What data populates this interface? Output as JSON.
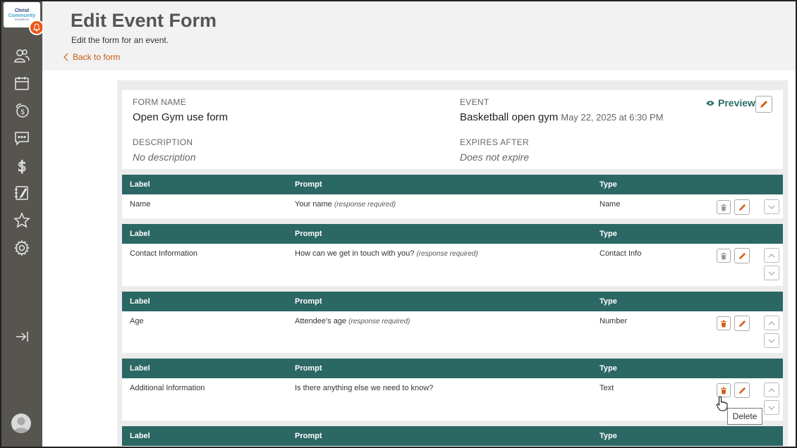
{
  "logo": {
    "line1": "Christ",
    "line2": "Community",
    "line3": "CHURCH"
  },
  "header": {
    "title": "Edit Event Form",
    "subtitle": "Edit the form for an event.",
    "back_link": "Back to form"
  },
  "form": {
    "form_name_label": "FORM NAME",
    "form_name_value": "Open Gym use form",
    "event_label": "EVENT",
    "event_value": "Basketball open gym",
    "event_date": "May 22, 2025 at 6:30 PM",
    "description_label": "DESCRIPTION",
    "description_value": "No description",
    "expires_label": "EXPIRES AFTER",
    "expires_value": "Does not expire",
    "preview_label": "Preview"
  },
  "columns": {
    "label": "Label",
    "prompt": "Prompt",
    "type": "Type"
  },
  "required_text": "(response required)",
  "questions": [
    {
      "label": "Name",
      "prompt": "Your name",
      "type": "Name"
    },
    {
      "label": "Contact Information",
      "prompt": "How can we get in touch with you?",
      "type": "Contact Info"
    },
    {
      "label": "Age",
      "prompt": "Attendee's age",
      "type": "Number"
    },
    {
      "label": "Additional Information",
      "prompt": "Is there anything else we need to know?",
      "type": "Text"
    }
  ],
  "tooltip": "Delete",
  "colors": {
    "sidebar": "#57554f",
    "teal": "#2b6763",
    "accent": "#e55a1c"
  }
}
